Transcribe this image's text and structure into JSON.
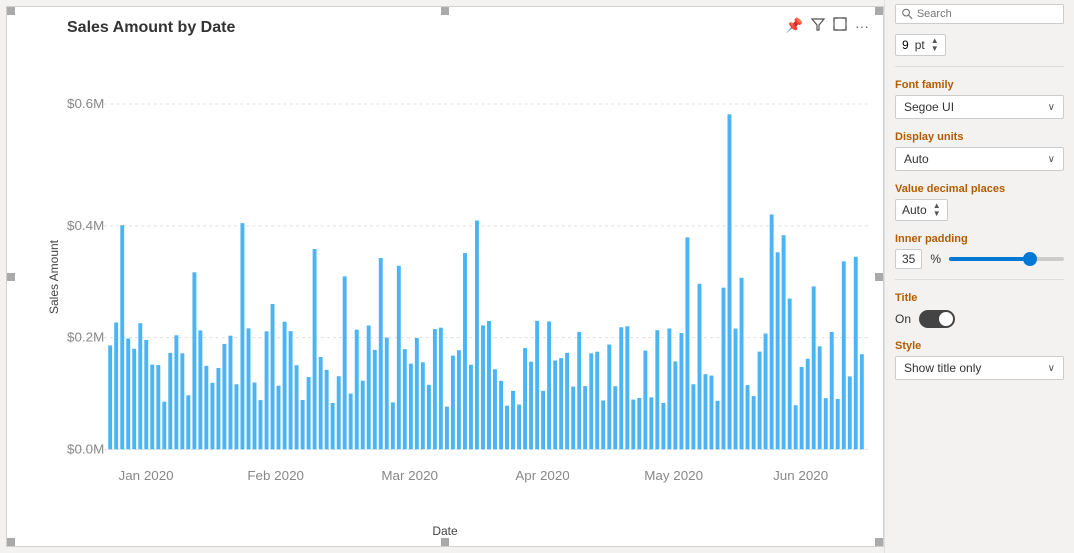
{
  "chart": {
    "title": "Sales Amount by Date",
    "y_axis_label": "Sales Amount",
    "x_axis_label": "Date",
    "x_ticks": [
      "Jan 2020",
      "Feb 2020",
      "Mar 2020",
      "Apr 2020",
      "May 2020",
      "Jun 2020"
    ],
    "y_ticks": [
      "$0.0M",
      "$0.2M",
      "$0.4M",
      "$0.6M"
    ],
    "toolbar_icons": [
      "pin-icon",
      "filter-icon",
      "expand-icon",
      "more-icon"
    ]
  },
  "panel": {
    "search_placeholder": "Search",
    "font_size": "9",
    "font_size_unit": "pt",
    "font_family_label": "Font family",
    "font_family_value": "Segoe UI",
    "display_units_label": "Display units",
    "display_units_value": "Auto",
    "value_decimal_label": "Value decimal places",
    "value_decimal_value": "Auto",
    "inner_padding_label": "Inner padding",
    "inner_padding_value": "35",
    "inner_padding_pct": "%",
    "inner_padding_slider_pct": 70,
    "title_section_label": "Title",
    "title_toggle_label": "On",
    "style_label": "Style",
    "style_value": "Show title only"
  }
}
